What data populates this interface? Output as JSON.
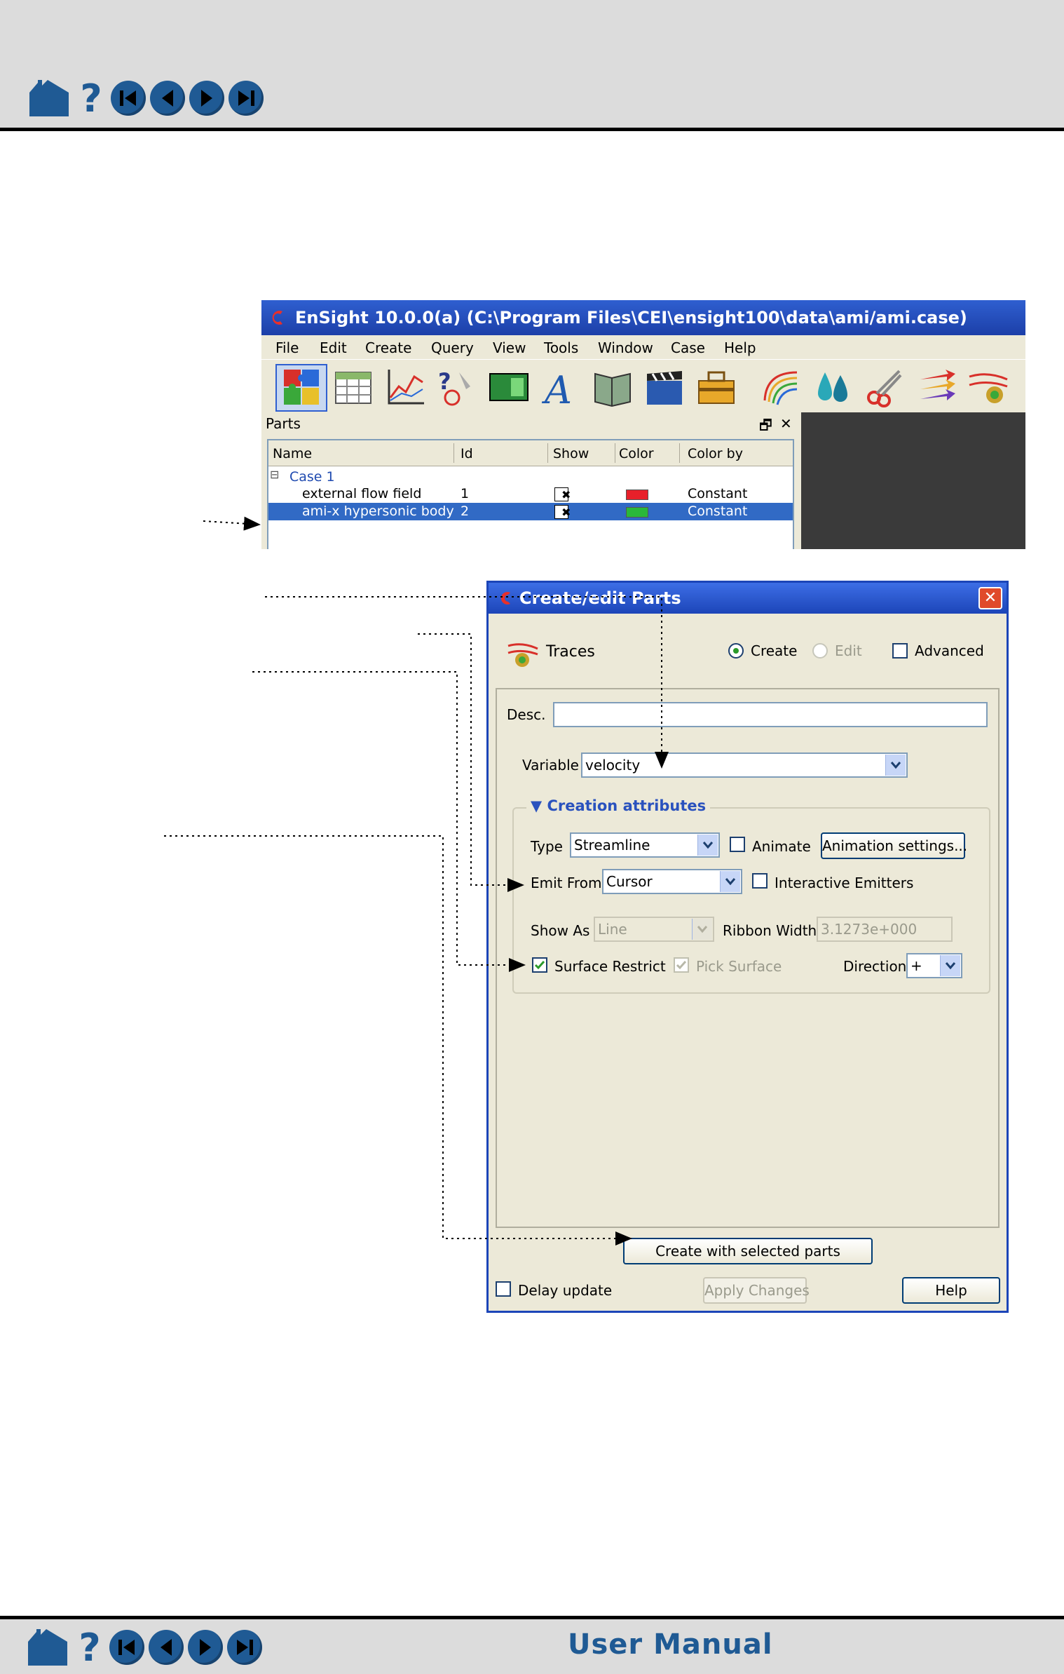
{
  "nav": {
    "home_icon": "home-icon",
    "help_symbol": "?",
    "footer_title": "User Manual"
  },
  "ensight": {
    "title": "EnSight 10.0.0(a) (C:\\Program Files\\CEI\\ensight100\\data\\ami/ami.case)",
    "menu": [
      "File",
      "Edit",
      "Create",
      "Query",
      "View",
      "Tools",
      "Window",
      "Case",
      "Help"
    ],
    "parts": {
      "header": "Parts",
      "columns": [
        "Name",
        "Id",
        "Show",
        "Color",
        "Color by"
      ],
      "case_label": "Case 1",
      "rows": [
        {
          "name": "external flow field",
          "id": "1",
          "show": "✖",
          "color": "#e8202a",
          "color_by": "Constant"
        },
        {
          "name": "ami-x hypersonic body",
          "id": "2",
          "show": "✖",
          "color": "#2ab83a",
          "color_by": "Constant"
        }
      ]
    }
  },
  "dialog": {
    "title": "Create/edit Parts",
    "close": "✕",
    "feature": "Traces",
    "mode_create": "Create",
    "mode_edit": "Edit",
    "advanced": "Advanced",
    "desc_label": "Desc.",
    "desc_value": "",
    "variable_label": "Variable",
    "variable_value": "velocity",
    "group_title": "▼  Creation attributes",
    "type_label": "Type",
    "type_value": "Streamline",
    "animate": "Animate",
    "animation_settings": "Animation settings...",
    "emit_from_label": "Emit From",
    "emit_from_value": "Cursor",
    "interactive_emitters": "Interactive Emitters",
    "show_as_label": "Show As",
    "show_as_value": "Line",
    "ribbon_width_label": "Ribbon Width",
    "ribbon_width_value": "3.1273e+000",
    "surface_restrict": "Surface Restrict",
    "pick_surface": "Pick Surface",
    "direction_label": "Direction",
    "direction_value": "+",
    "create_button": "Create with selected parts",
    "delay_update": "Delay update",
    "apply_changes": "Apply Changes",
    "help": "Help"
  },
  "colors": {
    "nav_blue": "#1f5a94",
    "title_blue": "#1c45b8",
    "xp_face": "#ece9d8",
    "selection": "#316ac5"
  }
}
